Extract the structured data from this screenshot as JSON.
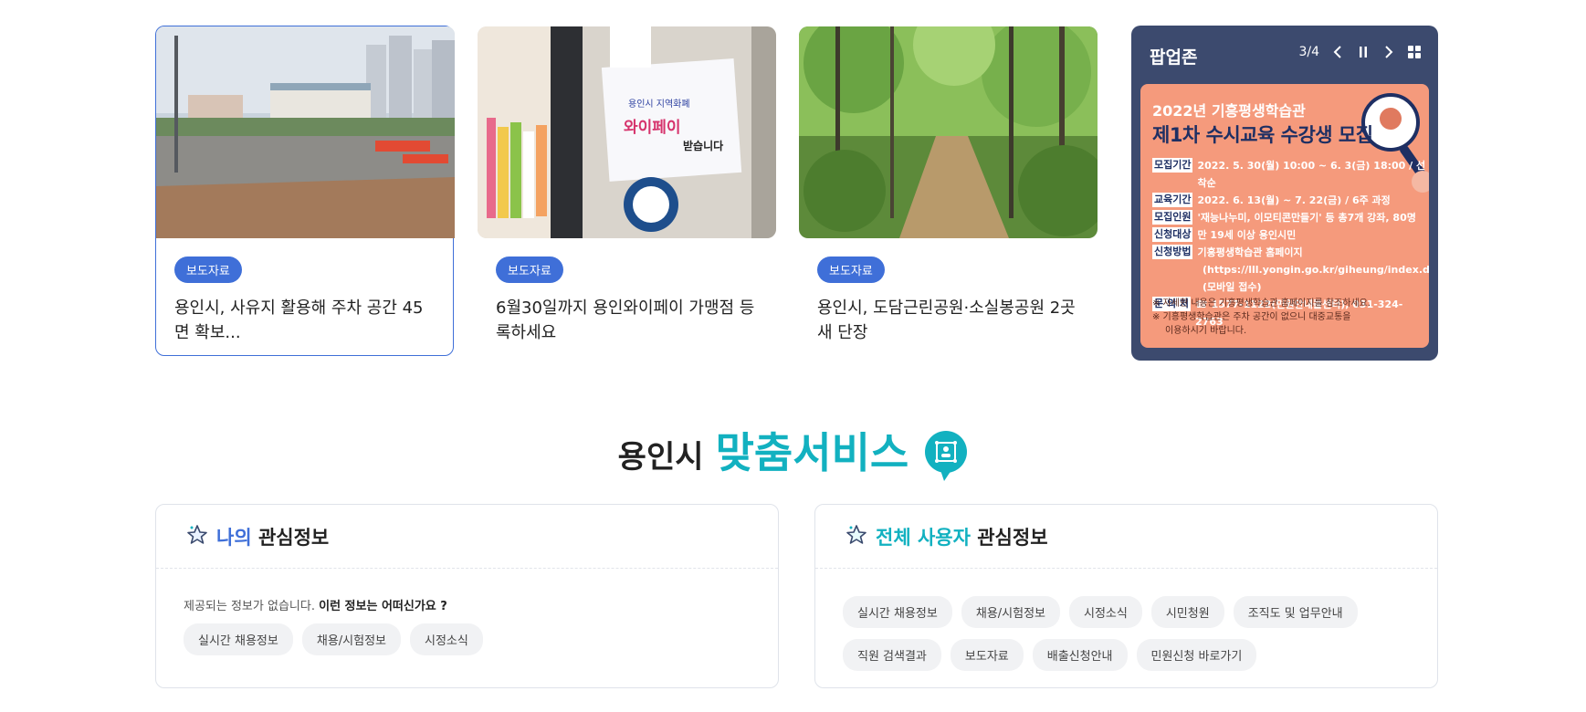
{
  "news": [
    {
      "badge": "보도자료",
      "title": "용인시, 사유지 활용해 주차 공간 45면 확보..."
    },
    {
      "badge": "보도자료",
      "title": "6월30일까지 용인와이페이 가맹점 등록하세요"
    },
    {
      "badge": "보도자료",
      "title": "용인시, 도담근린공원·소실봉공원 2곳 새 단장"
    }
  ],
  "photo_text": {
    "sign_line1": "용인시 지역화폐",
    "sign_line2": "와이페이",
    "sign_line3": "받습니다"
  },
  "popup": {
    "title": "팝업존",
    "counter": "3/4",
    "banner": {
      "year": "2022년 기흥평생학습관",
      "headline": "제1차 수시교육 수강생 모집",
      "rows": [
        {
          "key": "모집기간",
          "value": "2022. 5. 30(월) 10:00 ~ 6. 3(금) 18:00 / 선착순"
        },
        {
          "key": "교육기간",
          "value": "2022. 6. 13(월) ~ 7. 22(금) / 6주 과정"
        },
        {
          "key": "모집인원",
          "value": "'재능나누미, 이모티콘만들기' 등 총7개 강좌, 80명"
        },
        {
          "key": "신청대상",
          "value": "만 19세 이상 용인시민"
        },
        {
          "key": "신청방법",
          "value": "기흥평생학습관 홈페이지"
        },
        {
          "key": "",
          "value": "(https://lll.yongin.go.kr/giheung/index.do)"
        },
        {
          "key": "",
          "value": "(모바일 접수)"
        },
        {
          "key": "문 의 처",
          "value": "☎ 1577-1122(민원안내콜센터), 031-324-2763"
        }
      ],
      "notes": [
        "※ 자세한 내용은 기흥평생학습관 홈페이지를 참조하세요.",
        "※ 기흥평생학습관은 주차 공간이 없으니 대중교통을",
        "이용하시기 바랍니다."
      ]
    }
  },
  "service": {
    "title_prefix": "용인시",
    "title_main": "맞춤서비스"
  },
  "my_interest": {
    "title_hl": "나의",
    "title_rest": "관심정보",
    "empty_text": "제공되는 정보가 없습니다.",
    "empty_question": "이런 정보는 어떠신가요 ?",
    "chips": [
      "실시간 채용정보",
      "채용/시험정보",
      "시정소식"
    ]
  },
  "all_interest": {
    "title_hl": "전체 사용자",
    "title_rest": "관심정보",
    "chips": [
      "실시간 채용정보",
      "채용/시험정보",
      "시정소식",
      "시민청원",
      "조직도 및 업무안내",
      "직원 검색결과",
      "보도자료",
      "배출신청안내",
      "민원신청 바로가기"
    ]
  },
  "colors": {
    "accent_blue": "#3f6fd8",
    "accent_teal": "#12b1c0",
    "popup_bg": "#3c4a6e",
    "banner_bg": "#f59a7c"
  }
}
